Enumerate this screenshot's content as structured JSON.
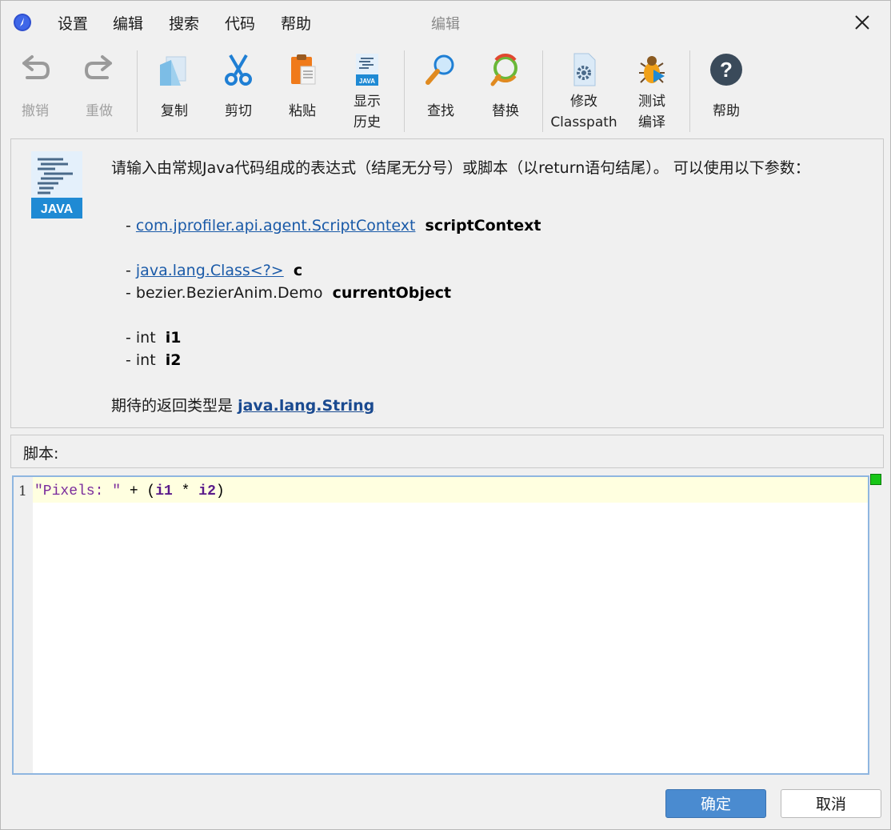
{
  "menu": [
    "设置",
    "编辑",
    "搜索",
    "代码",
    "帮助"
  ],
  "window_title": "编辑",
  "toolbar": {
    "undo": "撤销",
    "redo": "重做",
    "copy": "复制",
    "cut": "剪切",
    "paste": "粘贴",
    "history_1": "显示",
    "history_2": "历史",
    "find": "查找",
    "replace": "替换",
    "classpath_1": "修改",
    "classpath_2": "Classpath",
    "test_1": "测试",
    "test_2": "编译",
    "help": "帮助"
  },
  "info": {
    "logo_text": "JAVA",
    "description": "请输入由常规Java代码组成的表达式（结尾无分号）或脚本（以return语句结尾）。 可以使用以下参数：",
    "params": [
      {
        "type": "com.jprofiler.api.agent.ScriptContext",
        "name": "scriptContext",
        "link": true
      },
      {
        "type": "java.lang.Class<?>",
        "name": "c",
        "link": true
      },
      {
        "type": "bezier.BezierAnim.Demo",
        "name": "currentObject",
        "link": false
      },
      {
        "type": "int",
        "name": "i1",
        "link": false
      },
      {
        "type": "int",
        "name": "i2",
        "link": false
      }
    ],
    "return_prefix": "期待的返回类型是",
    "return_type": "java.lang.String"
  },
  "script_label": "脚本:",
  "editor": {
    "line_number": "1",
    "code_string": "\"Pixels: \"",
    "code_plus": " + (",
    "code_i1": "i1",
    "code_mul": " * ",
    "code_i2": "i2",
    "code_close": ")"
  },
  "buttons": {
    "ok": "确定",
    "cancel": "取消"
  },
  "colors": {
    "accent": "#4a8bd0",
    "link": "#1a5aa8",
    "indicator": "#17c617",
    "highlight": "#ffffe0"
  }
}
